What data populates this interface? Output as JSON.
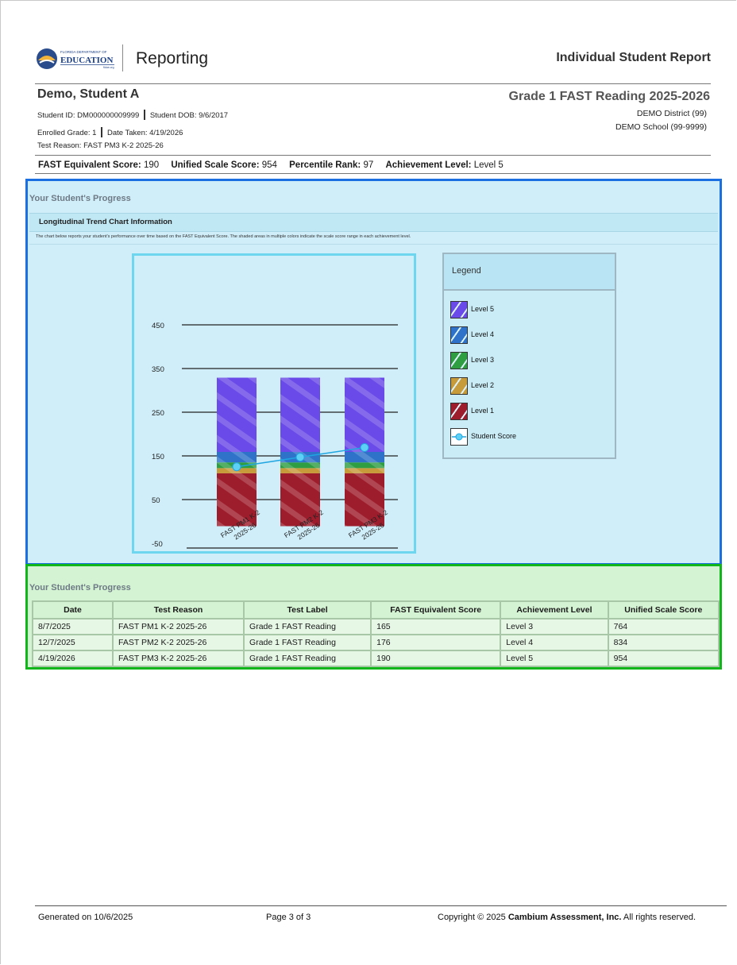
{
  "header": {
    "logo_text_top": "FLORIDA DEPARTMENT OF",
    "logo_text_main": "EDUCATION",
    "logo_text_sub": "fldoe.org",
    "app_title": "Reporting",
    "report_title": "Individual Student Report"
  },
  "student": {
    "name": "Demo, Student A",
    "id_line": "Student ID: DM000000009999",
    "dob_line": "Student DOB: 9/6/2017",
    "grade_line": "Enrolled Grade: 1",
    "date_line": "Date Taken: 4/19/2026",
    "reason_line": "Test Reason: FAST PM3 K-2 2025-26",
    "test_title": "Grade 1 FAST Reading 2025-2026",
    "district": "DEMO District (99)",
    "school": "DEMO School (99-9999)"
  },
  "scores": {
    "fast_label": "FAST Equivalent Score:",
    "fast_value": "190",
    "uss_label": "Unified Scale Score:",
    "uss_value": "954",
    "pr_label": "Percentile Rank:",
    "pr_value": "97",
    "al_label": "Achievement Level:",
    "al_value": "Level 5"
  },
  "progress": {
    "title": "Your Student's Progress",
    "section_header": "Longitudinal Trend Chart Information",
    "description": "The chart below reports your student's performance over time based on the FAST Equivalent Score. The shaded areas in multiple colors indicate the scale score range in each achievement level."
  },
  "chart_data": {
    "type": "bar",
    "categories": [
      "FAST PM1 K-2 2025-26",
      "FAST PM2 K-2 2025-26",
      "FAST PM3 K-2 2025-26"
    ],
    "category_lines": [
      [
        "FAST PM1 K-2",
        "2025-26"
      ],
      [
        "FAST PM2 K-2",
        "2025-26"
      ],
      [
        "FAST PM3 K-2",
        "2025-26"
      ]
    ],
    "yticks": [
      450,
      350,
      250,
      150,
      50,
      -50
    ],
    "ylim": [
      -50,
      450
    ],
    "stacked_levels": [
      {
        "name": "Level 1",
        "from": 0,
        "to": 121,
        "color": "#9e1d2c"
      },
      {
        "name": "Level 2",
        "from": 121,
        "to": 133,
        "color": "#c79a3a"
      },
      {
        "name": "Level 3",
        "from": 133,
        "to": 146,
        "color": "#2f9e43"
      },
      {
        "name": "Level 4",
        "from": 146,
        "to": 170,
        "color": "#2e73c9"
      },
      {
        "name": "Level 5",
        "from": 170,
        "to": 340,
        "color": "#6a4ae8"
      }
    ],
    "series": [
      {
        "name": "Student Score",
        "values": [
          136,
          158,
          180
        ],
        "color": "#1fa6e0"
      }
    ],
    "legend": {
      "title": "Legend",
      "placement": "right"
    },
    "grid": true
  },
  "legend_items": [
    {
      "label": "Level 5",
      "color": "#6a4ae8"
    },
    {
      "label": "Level 4",
      "color": "#2e73c9"
    },
    {
      "label": "Level 3",
      "color": "#2f9e43"
    },
    {
      "label": "Level 2",
      "color": "#c79a3a"
    },
    {
      "label": "Level 1",
      "color": "#9e1d2c"
    },
    {
      "label": "Student Score",
      "color": "#1fa6e0"
    }
  ],
  "table": {
    "title": "Your Student's Progress",
    "columns": [
      "Date",
      "Test Reason",
      "Test Label",
      "FAST Equivalent Score",
      "Achievement Level",
      "Unified Scale Score"
    ],
    "rows": [
      [
        "8/7/2025",
        "FAST PM1 K-2 2025-26",
        "Grade 1 FAST Reading",
        "165",
        "Level 3",
        "764"
      ],
      [
        "12/7/2025",
        "FAST PM2 K-2 2025-26",
        "Grade 1 FAST Reading",
        "176",
        "Level 4",
        "834"
      ],
      [
        "4/19/2026",
        "FAST PM3 K-2 2025-26",
        "Grade 1 FAST Reading",
        "190",
        "Level 5",
        "954"
      ]
    ]
  },
  "footer": {
    "generated": "Generated on 10/6/2025",
    "page": "Page 3 of 3",
    "copyright_pre": "Copyright © 2025 ",
    "copyright_company": "Cambium Assessment, Inc.",
    "copyright_post": " All rights reserved."
  }
}
